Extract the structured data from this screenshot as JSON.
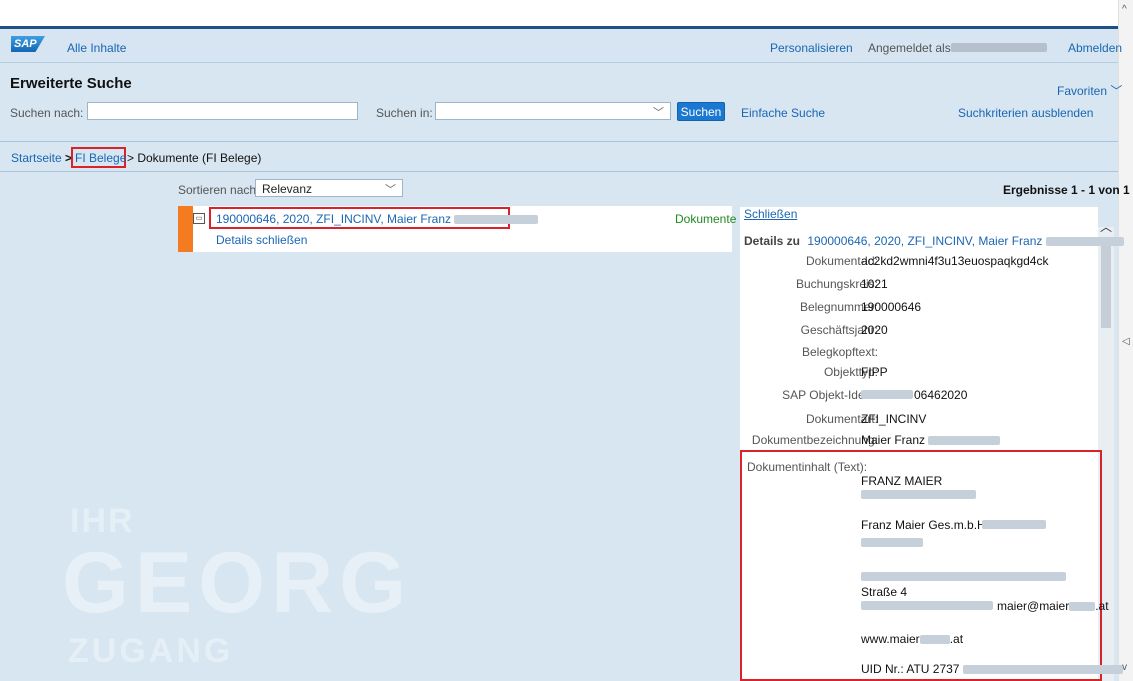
{
  "header": {
    "logo": "SAP",
    "all_content": "Alle Inhalte",
    "personalize": "Personalisieren",
    "logged_in_label": "Angemeldet als:",
    "logout": "Abmelden"
  },
  "search": {
    "title": "Erweiterte Suche",
    "favorites": "Favoriten",
    "search_for_label": "Suchen nach:",
    "search_for_value": "",
    "search_in_label": "Suchen in:",
    "search_in_value": "",
    "search_button": "Suchen",
    "simple_search": "Einfache Suche",
    "hide_criteria": "Suchkriterien ausblenden"
  },
  "breadcrumb": {
    "home": "Startseite",
    "level1": "FI Belege",
    "current": "> Dokumente (FI Belege)",
    "separator": ">"
  },
  "results": {
    "sort_label": "Sortieren nach:",
    "sort_value": "Relevanz",
    "count": "Ergebnisse 1 - 1 von 1",
    "items": [
      {
        "title": "190000646, 2020, ZFI_INCINV, Maier Franz",
        "close_details": "Details schließen",
        "category": "Dokumente"
      }
    ]
  },
  "details": {
    "close": "Schließen",
    "details_for": "Details zu",
    "details_title": "190000646, 2020, ZFI_INCINV, Maier Franz",
    "fields": [
      {
        "label": "Dokument-Id:",
        "value": "ac2kd2wmni4f3u13euospaqkgd4ck"
      },
      {
        "label": "Buchungskreis:",
        "value": "1021"
      },
      {
        "label": "Belegnummer:",
        "value": "190000646"
      },
      {
        "label": "Geschäftsjahr:",
        "value": "2020"
      },
      {
        "label": "Belegkopftext:",
        "value": ""
      },
      {
        "label": "Objekttyp:",
        "value": "FIPP"
      },
      {
        "label": "SAP Objekt-Ident:",
        "value": "06462020"
      },
      {
        "label": "Dokumentart:",
        "value": "ZFI_INCINV"
      },
      {
        "label": "Dokumentbezeichnung:",
        "value": "Maier Franz"
      }
    ],
    "content_label": "Dokumentinhalt (Text):",
    "content_lines": {
      "name": "FRANZ MAIER",
      "company": "Franz Maier Ges.m.b.H",
      "street": "Straße 4",
      "email": "maier@maier",
      "email_suffix": ".at",
      "web": "www.maier",
      "web_suffix": ".at",
      "uid": "UID Nr.: ATU 2737"
    }
  },
  "watermark": {
    "line1": "IHR",
    "line2": "GEORG",
    "line3": "ZUGANG"
  }
}
